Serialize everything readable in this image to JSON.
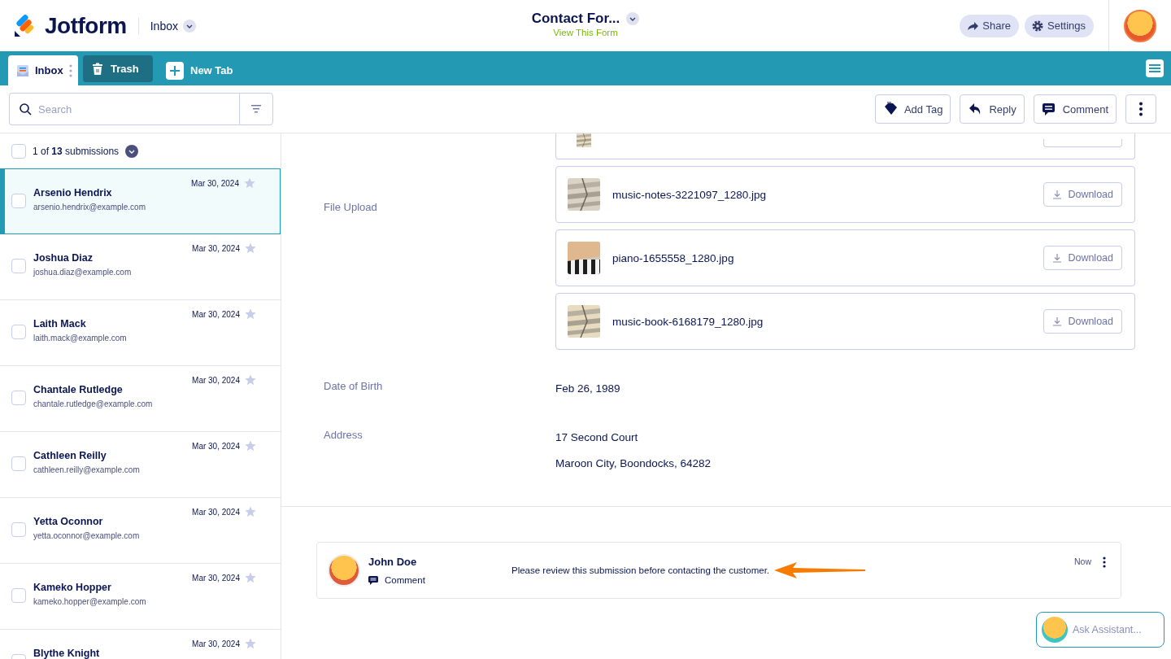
{
  "header": {
    "logo": "Jotform",
    "section": "Inbox",
    "form_title": "Contact For...",
    "form_link": "View This Form",
    "buttons": [
      "Share",
      "Settings"
    ]
  },
  "tabs": [
    {
      "label": "Inbox",
      "selected": true
    },
    {
      "label": "Trash",
      "selected": false
    },
    {
      "label": "New Tab",
      "selected": false,
      "kind": "add"
    }
  ],
  "search": {
    "placeholder": "Search"
  },
  "toolbar": [
    "Add Tag",
    "Reply",
    "Comment"
  ],
  "list_header": {
    "checked": false,
    "count": "1 of **13** submissions"
  },
  "submissions": [
    {
      "name": "Arsenio Hendrix",
      "email": "arsenio.hendrix@example.com",
      "date": "Mar 30, 2024",
      "selected": true,
      "checked": false
    },
    {
      "name": "Joshua Diaz",
      "email": "joshua.diaz@example.com",
      "date": "Mar 30, 2024",
      "selected": false,
      "checked": false
    },
    {
      "name": "Laith Mack",
      "email": "laith.mack@example.com",
      "date": "Mar 30, 2024",
      "selected": false,
      "checked": false
    },
    {
      "name": "Chantale Rutledge",
      "email": "chantale.rutledge@example.com",
      "date": "Mar 30, 2024",
      "selected": false,
      "checked": false
    },
    {
      "name": "Cathleen Reilly",
      "email": "cathleen.reilly@example.com",
      "date": "Mar 30, 2024",
      "selected": false,
      "checked": false
    },
    {
      "name": "Yetta Oconnor",
      "email": "yetta.oconnor@example.com",
      "date": "Mar 30, 2024",
      "selected": false,
      "checked": false
    },
    {
      "name": "Kameko Hopper",
      "email": "kameko.hopper@example.com",
      "date": "Mar 30, 2024",
      "selected": false,
      "checked": false
    },
    {
      "name": "Blythe Knight",
      "date": "Mar 30, 2024",
      "selected": false,
      "checked": false
    }
  ],
  "fields": [
    {
      "label": "File Upload",
      "kind": "files",
      "files": [
        {
          "kind": "partial"
        },
        {
          "name": "music-notes-3221097_1280.jpg",
          "button": "Download"
        },
        {
          "name": "piano-1655558_1280.jpg",
          "button": "Download"
        },
        {
          "name": "music-book-6168179_1280.jpg",
          "button": "Download"
        }
      ]
    },
    {
      "label": "Date of Birth",
      "kind": "text",
      "lines": [
        "Feb 26, 1989"
      ]
    },
    {
      "label": "Address",
      "kind": "text",
      "lines": [
        "17 Second Court",
        "Maroon City, Boondocks, 64282"
      ]
    }
  ],
  "comment": {
    "author": "John Doe",
    "type": "Comment",
    "text": "Please review this submission before contacting the customer.",
    "time": "Now"
  },
  "assistant": {
    "label": "Ask Assistant..."
  }
}
